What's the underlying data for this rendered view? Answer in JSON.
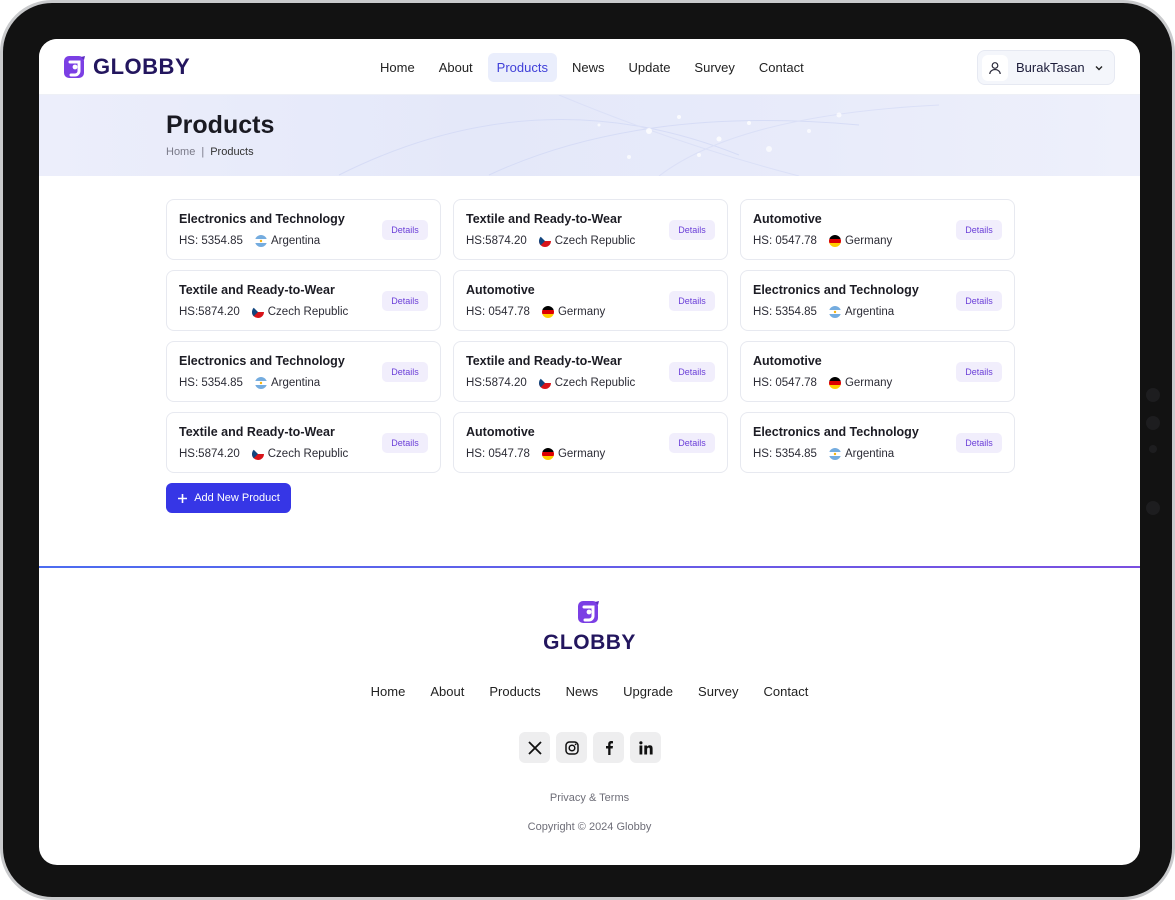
{
  "app": {
    "name": "GLOBBY"
  },
  "header": {
    "nav": [
      {
        "label": "Home",
        "active": false
      },
      {
        "label": "About",
        "active": false
      },
      {
        "label": "Products",
        "active": true
      },
      {
        "label": "News",
        "active": false
      },
      {
        "label": "Update",
        "active": false
      },
      {
        "label": "Survey",
        "active": false
      },
      {
        "label": "Contact",
        "active": false
      }
    ],
    "user": {
      "name": "BurakTasan",
      "icon": "user-icon",
      "dropdown_icon": "chevron-down-icon"
    }
  },
  "hero": {
    "title": "Products",
    "breadcrumb": {
      "home": "Home",
      "separator": "|",
      "current": "Products"
    }
  },
  "products": [
    {
      "category": "Electronics and Technology",
      "hs": "HS: 5354.85",
      "country": "Argentina",
      "details": "Details"
    },
    {
      "category": "Textile and Ready-to-Wear",
      "hs": "HS:5874.20",
      "country": "Czech Republic",
      "details": "Details"
    },
    {
      "category": "Automotive",
      "hs": "HS: 0547.78",
      "country": "Germany",
      "details": "Details"
    },
    {
      "category": "Textile and Ready-to-Wear",
      "hs": "HS:5874.20",
      "country": "Czech Republic",
      "details": "Details"
    },
    {
      "category": "Automotive",
      "hs": "HS: 0547.78",
      "country": "Germany",
      "details": "Details"
    },
    {
      "category": "Electronics and Technology",
      "hs": "HS: 5354.85",
      "country": "Argentina",
      "details": "Details"
    },
    {
      "category": "Electronics and Technology",
      "hs": "HS: 5354.85",
      "country": "Argentina",
      "details": "Details"
    },
    {
      "category": "Textile and Ready-to-Wear",
      "hs": "HS:5874.20",
      "country": "Czech Republic",
      "details": "Details"
    },
    {
      "category": "Automotive",
      "hs": "HS: 0547.78",
      "country": "Germany",
      "details": "Details"
    },
    {
      "category": "Textile and Ready-to-Wear",
      "hs": "HS:5874.20",
      "country": "Czech Republic",
      "details": "Details"
    },
    {
      "category": "Automotive",
      "hs": "HS: 0547.78",
      "country": "Germany",
      "details": "Details"
    },
    {
      "category": "Electronics and Technology",
      "hs": "HS: 5354.85",
      "country": "Argentina",
      "details": "Details"
    }
  ],
  "actions": {
    "add_product": "Add New Product"
  },
  "footer": {
    "nav": [
      "Home",
      "About",
      "Products",
      "News",
      "Upgrade",
      "Survey",
      "Contact"
    ],
    "socials": [
      "x-icon",
      "instagram-icon",
      "facebook-icon",
      "linkedin-icon"
    ],
    "terms": "Privacy & Terms",
    "copyright": "Copyright © 2024 Globby"
  },
  "colors": {
    "brand": "#23165e",
    "accent": "#3636e6",
    "logo_purple": "#7b3fe4",
    "details_text": "#6b3fd8"
  }
}
